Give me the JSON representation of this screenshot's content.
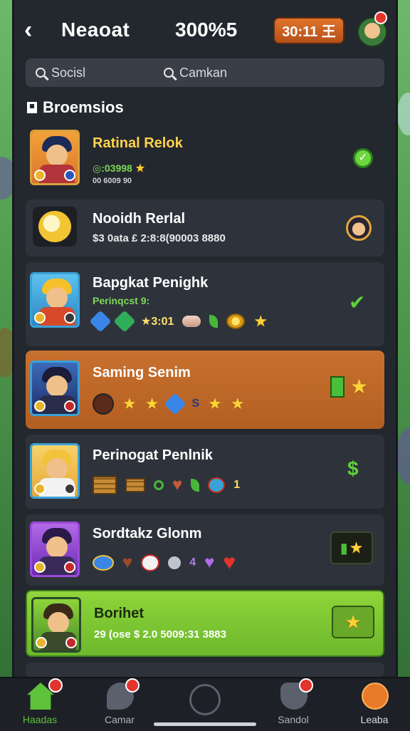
{
  "header": {
    "back_icon": "chevron-left-icon",
    "title": "Neaoat",
    "score": "300%5",
    "timer": "30:11 王",
    "profile_icon": "avatar-icon"
  },
  "search": {
    "left_label": "Socisl",
    "right_label": "Camkan"
  },
  "section": {
    "title": "Broemsios"
  },
  "items": [
    {
      "name": "Ratinal Relok",
      "line1": "◎:03998",
      "line2": "00 6009 90",
      "status": "checkmark-circle"
    },
    {
      "name": "Nooidh Rerlal",
      "line1": "$3 0ata £ 2:8:8(90003 8880",
      "status": "avatar"
    },
    {
      "name": "Bapgkat Penighk",
      "line1": "Perinqcst 9:",
      "extra": "★3:01",
      "status": "checkmark"
    },
    {
      "name": "Saming Senim",
      "extra": "S",
      "status": "reward"
    },
    {
      "name": "Perinogat Penlnik",
      "extra": "1",
      "status": "dollar"
    },
    {
      "name": "Sordtakz Glonm",
      "extra": "4",
      "status": "reward-box"
    },
    {
      "name": "Borihet",
      "line1": "29 (ose $ 2.0 5009:31 3883",
      "status": "star-box"
    }
  ],
  "nav": [
    {
      "label": "Haadas",
      "icon": "home-icon"
    },
    {
      "label": "Camar",
      "icon": "chat-icon"
    },
    {
      "label": "",
      "icon": "center-circle-icon"
    },
    {
      "label": "Sandol",
      "icon": "shield-icon"
    },
    {
      "label": "Leaba",
      "icon": "rank-icon"
    }
  ],
  "colors": {
    "panel": "#23272e",
    "accent_orange": "#c8702e",
    "accent_green": "#8fd53a",
    "gold": "#ffd34a"
  }
}
